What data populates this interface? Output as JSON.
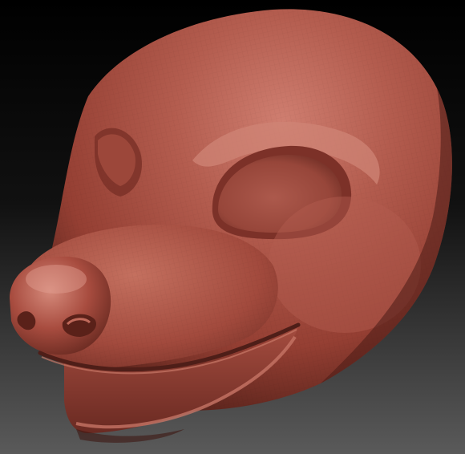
{
  "scene": {
    "subject_icon": "sculpted-animal-head-icon",
    "colors": {
      "background_top": "#000000",
      "background_bottom": "#5a5a5a",
      "clay_base": "#a1493c",
      "clay_shadow": "#6b2b22",
      "clay_highlight": "#d58a7b",
      "clay_deep": "#4e1e18"
    }
  }
}
